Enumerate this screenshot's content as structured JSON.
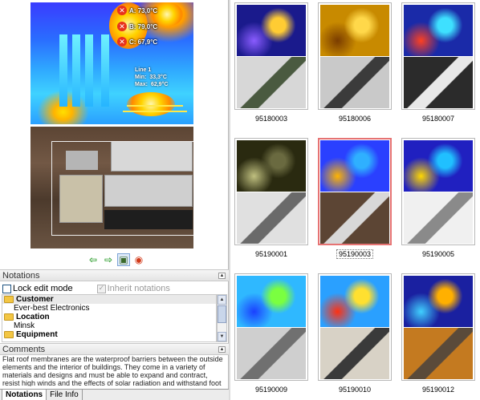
{
  "main_image": {
    "markers": [
      {
        "label": "A: 73,0°C",
        "glyph": "✕"
      },
      {
        "label": "B: 79,0°C",
        "glyph": "✕"
      },
      {
        "label": "C: 67,9°C",
        "glyph": "✕"
      }
    ],
    "line": {
      "title": "Line 1",
      "min_label": "Min:",
      "min_value": "33,3°C",
      "max_label": "Max:",
      "max_value": "62,9°C"
    }
  },
  "toolbar": {
    "prev_glyph": "⇦",
    "next_glyph": "⇨",
    "image_glyph": "▣",
    "palette_glyph": "◉"
  },
  "notations": {
    "header": "Notations",
    "lock_label": "Lock edit mode",
    "inherit_label": "Inherit notations",
    "tree": [
      {
        "text": "Customer",
        "type": "category"
      },
      {
        "text": "Ever-best Electronics",
        "type": "value"
      },
      {
        "text": "Location",
        "type": "category"
      },
      {
        "text": "Minsk",
        "type": "value"
      },
      {
        "text": "Equipment",
        "type": "category"
      }
    ]
  },
  "comments": {
    "header": "Comments",
    "text": "Flat roof membranes are the waterproof barriers between the outside elements and the interior of buildings. They come in a variety of materials and designs and must be able to expand and contract, resist high winds and the effects of solar radiation and withstand foot traffic. It is easy to see why roofs leak..."
  },
  "tabs": [
    {
      "label": "Notations",
      "active": true
    },
    {
      "label": "File Info",
      "active": false
    }
  ],
  "thumbnails": [
    {
      "name": "95180003",
      "selected": false,
      "ir_colors": [
        "#1a1a8c",
        "#ffcc33",
        "#8a5cff"
      ],
      "photo_colors": [
        "#d7d7d7",
        "#4a5a40"
      ]
    },
    {
      "name": "95180006",
      "selected": false,
      "ir_colors": [
        "#c88a00",
        "#ffd84a",
        "#7a3c00"
      ],
      "photo_colors": [
        "#c9c9c9",
        "#3b3b3b"
      ]
    },
    {
      "name": "95180007",
      "selected": false,
      "ir_colors": [
        "#1a2aa8",
        "#3ee0ff",
        "#ff4020"
      ],
      "photo_colors": [
        "#2b2b2b",
        "#e8e8e8"
      ]
    },
    {
      "name": "95190001",
      "selected": false,
      "ir_colors": [
        "#2a2a10",
        "#6a6a40",
        "#c0c080"
      ],
      "photo_colors": [
        "#e0e0e0",
        "#6a6a6a"
      ]
    },
    {
      "name": "95190003",
      "selected": true,
      "ir_colors": [
        "#2a40ff",
        "#2fb0ff",
        "#ffb400"
      ],
      "photo_colors": [
        "#5c4534",
        "#d8d8d8"
      ]
    },
    {
      "name": "95190005",
      "selected": false,
      "ir_colors": [
        "#2020c0",
        "#20c0ff",
        "#ffd800"
      ],
      "photo_colors": [
        "#f0f0f0",
        "#8a8a8a"
      ]
    },
    {
      "name": "95190009",
      "selected": false,
      "ir_colors": [
        "#2fb8ff",
        "#7aff40",
        "#1a40ff"
      ],
      "photo_colors": [
        "#cfcfcf",
        "#707070"
      ]
    },
    {
      "name": "95190010",
      "selected": false,
      "ir_colors": [
        "#2aa0ff",
        "#ffe030",
        "#ff3010"
      ],
      "photo_colors": [
        "#d8d2c6",
        "#3a3a3a"
      ]
    },
    {
      "name": "95190012",
      "selected": false,
      "ir_colors": [
        "#1a20a0",
        "#ffb000",
        "#40d0ff"
      ],
      "photo_colors": [
        "#c47a20",
        "#5a4a3a"
      ]
    }
  ]
}
